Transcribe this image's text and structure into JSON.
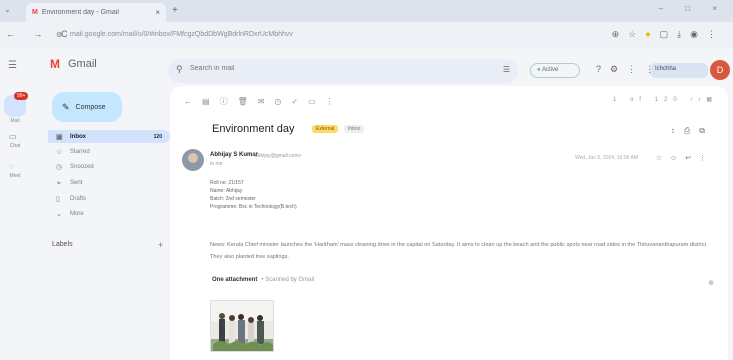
{
  "browser": {
    "tab_title": "Environment day - Gmail",
    "tab_close": "×",
    "new_tab": "+",
    "url": "mail.google.com/mail/u/0/#inbox/FMfcgzQbdDbWgBdrlnRDxrUcMbhhvv",
    "nav_icons": "← → C",
    "window_controls": "– □ ×"
  },
  "gmail": {
    "product_name": "Gmail",
    "search_placeholder": "Search in mail",
    "status": "Active",
    "account": "Ichchha",
    "avatar_initial": "D"
  },
  "rail": {
    "mail_label": "Mail",
    "mail_badge": "99+",
    "chat_label": "Chat",
    "meet_label": "Meet"
  },
  "sidebar": {
    "compose": "Compose",
    "items": [
      {
        "label": "Inbox",
        "count": "120"
      },
      {
        "label": "Starred",
        "count": ""
      },
      {
        "label": "Snoozed",
        "count": ""
      },
      {
        "label": "Sent",
        "count": ""
      },
      {
        "label": "Drafts",
        "count": ""
      },
      {
        "label": "More",
        "count": ""
      }
    ],
    "labels_heading": "Labels"
  },
  "message": {
    "pager": "1 of 120",
    "subject": "Environment day",
    "tag_external": "External",
    "tag_inbox": "Inbox",
    "sender_name": "Abhijay S Kumar",
    "sender_email": "<abhijay@gmail.com>",
    "to": "to me",
    "date": "Wed, Jun 5, 2024, 10:00 AM",
    "details": [
      "Roll no: 21/157",
      "Name: Abhijay",
      "Batch: 2nd semester",
      "Programme: Bsc in Technology(B.tech)"
    ],
    "body": "News: Kerala Chief minister launches the 'Haritham' mass cleaning drive in the capital on Saturday. It aims to clean up the beach and the public spots near road sides in the Thiruvananthapuram district. They also planted tree saplings.",
    "attachment_heading": "One attachment",
    "attachment_scan": "• Scanned by Gmail"
  }
}
